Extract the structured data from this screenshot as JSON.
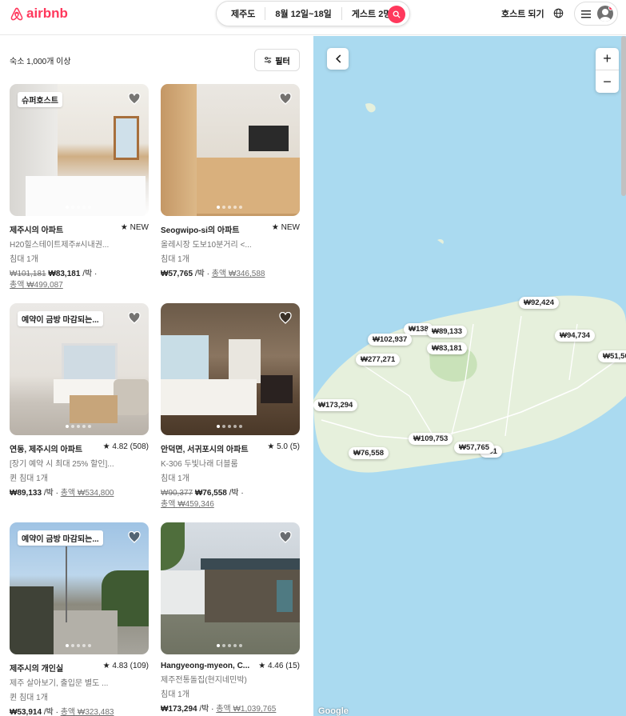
{
  "header": {
    "logo_text": "airbnb",
    "search": {
      "location": "제주도",
      "dates": "8월 12일~18일",
      "guests": "게스트 2명"
    },
    "host_link": "호스트 되기"
  },
  "list": {
    "count": "숙소 1,000개 이상",
    "filter_label": "필터",
    "cards": [
      {
        "badge": "슈퍼호스트",
        "title": "제주시의 아파트",
        "rating": "★ NEW",
        "desc": "H20힐스테이트제주#시내권...",
        "beds": "침대 1개",
        "old_price": "₩101,181",
        "price": "₩83,181",
        "per_night": "/박 ·",
        "total_label": "총액",
        "total": "₩499,087"
      },
      {
        "badge": "",
        "title": "Seogwipo-si의 아파트",
        "rating": "★ NEW",
        "desc": "올레시장 도보10분거리 <...",
        "beds": "침대 1개",
        "old_price": "",
        "price": "₩57,765",
        "per_night": "/박 ·",
        "total_label": "총액",
        "total": "₩346,588"
      },
      {
        "badge": "예약이 금방 마감되는...",
        "title": "연동, 제주시의 아파트",
        "rating": "★ 4.82 (508)",
        "desc": "[장기 예약 시 최대 25% 할인]...",
        "beds": "퀸 침대 1개",
        "old_price": "",
        "price": "₩89,133",
        "per_night": "/박 ·",
        "total_label": "총액",
        "total": "₩534,800"
      },
      {
        "badge": "",
        "title": "안덕면, 서귀포시의 아파트",
        "rating": "★ 5.0 (5)",
        "desc": "K-306 두빛나래 더블룸",
        "beds": "침대 1개",
        "old_price": "₩90,377",
        "price": "₩76,558",
        "per_night": "/박 ·",
        "total_label": "총액",
        "total": "₩459,346"
      },
      {
        "badge": "예약이 금방 마감되는...",
        "title": "제주시의 개인실",
        "rating": "★ 4.83 (109)",
        "desc": "제주 살아보기, 출입문 별도 ...",
        "beds": "퀸 침대 1개",
        "old_price": "",
        "price": "₩53,914",
        "per_night": "/박 ·",
        "total_label": "총액",
        "total": "₩323,483"
      },
      {
        "badge": "",
        "title": "Hangyeong-myeon, C...",
        "rating": "★ 4.46 (15)",
        "desc": "제주전통돌집(현지네민박)",
        "beds": "침대 1개",
        "old_price": "",
        "price": "₩173,294",
        "per_night": "/박 ·",
        "total_label": "총액",
        "total": "₩1,039,765"
      }
    ]
  },
  "map": {
    "pins": [
      "₩92,424",
      "₩138",
      "₩89,133",
      "₩94,734",
      "₩102,937",
      "₩83,181",
      "₩277,271",
      "₩51,50",
      "₩173,294",
      "₩109,753",
      "₩57,765",
      "₩76,558",
      "551"
    ],
    "zoom_in": "+",
    "zoom_out": "−",
    "attribution": "Google",
    "water_color": "#aadaf0",
    "land_color": "#e6f0dc",
    "accent_color": "#ff385c"
  }
}
